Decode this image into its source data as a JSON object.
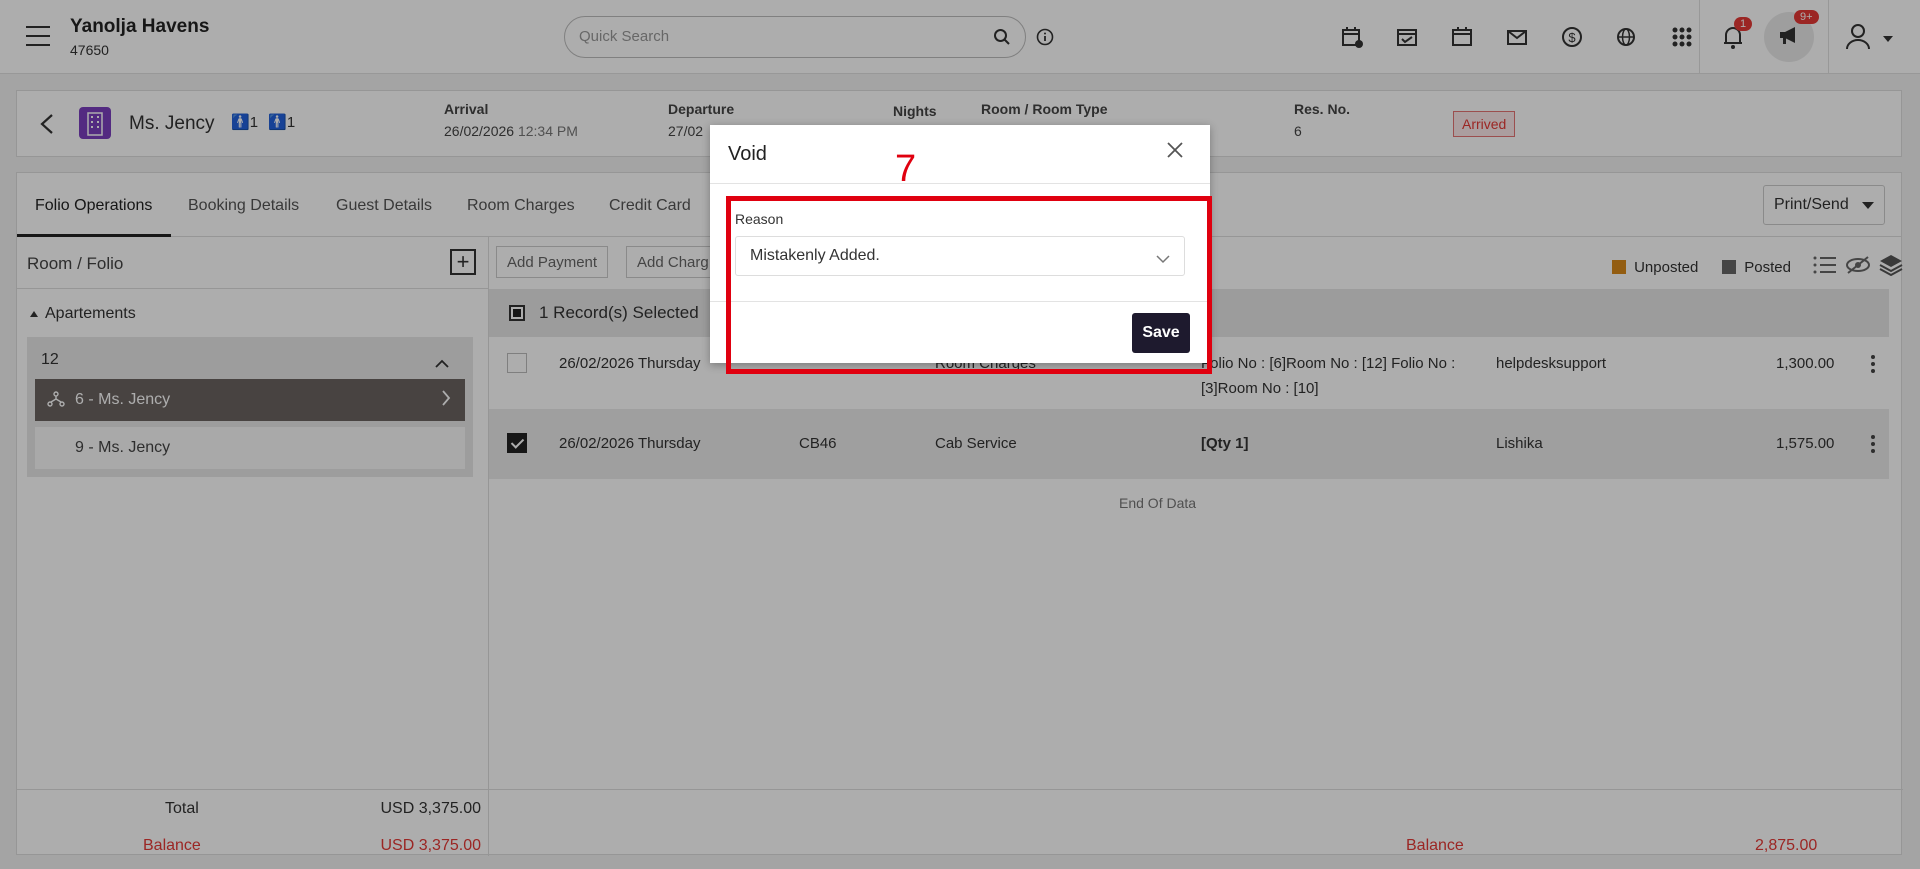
{
  "header": {
    "hotel_name": "Yanolja Havens",
    "hotel_code": "47650",
    "search_placeholder": "Quick Search",
    "notification_count": "1",
    "announcement_count": "9+"
  },
  "reservation": {
    "guest_name": "Ms. Jency",
    "adults": "1",
    "children": "1",
    "arrival_label": "Arrival",
    "arrival_date": "26/02/2026",
    "arrival_time": "12:34 PM",
    "departure_label": "Departure",
    "departure_value": "27/02",
    "nights_label": "Nights",
    "room_type_label": "Room / Room Type",
    "res_no_label": "Res. No.",
    "res_no_value": "6",
    "status": "Arrived"
  },
  "tabs": [
    "Folio Operations",
    "Booking Details",
    "Guest Details",
    "Room Charges",
    "Credit Card"
  ],
  "print_send_label": "Print/Send",
  "left_pane": {
    "title": "Room / Folio",
    "group": "Apartements",
    "room": "12",
    "folios": [
      "6 - Ms. Jency",
      "9 - Ms. Jency"
    ],
    "total_label": "Total",
    "total_value": "USD 3,375.00",
    "balance_label": "Balance",
    "balance_value": "USD 3,375.00"
  },
  "toolbar": {
    "add_payment": "Add Payment",
    "add_charge": "Add Charg",
    "legend_unposted": "Unposted",
    "legend_posted": "Posted"
  },
  "selection_text": "1 Record(s) Selected",
  "rows": [
    {
      "date": "26/02/2026 Thursday",
      "code": "",
      "desc": "Room Charges",
      "detail_1": "Folio No : [6]Room No : [12] Folio No :",
      "detail_2": "[3]Room No : [10]",
      "user": "helpdesksupport",
      "amount": "1,300.00"
    },
    {
      "date": "26/02/2026 Thursday",
      "code": "CB46",
      "desc": "Cab Service",
      "detail_1": "[Qty 1]",
      "detail_2": "",
      "user": "Lishika",
      "amount": "1,575.00"
    }
  ],
  "end_of_data": "End Of Data",
  "right_balance_label": "Balance",
  "right_balance_value": "2,875.00",
  "dialog": {
    "title": "Void",
    "reason_label": "Reason",
    "reason_value": "Mistakenly Added.",
    "save_label": "Save"
  },
  "step_number": "7",
  "colors": {
    "unposted": "#d98a1a",
    "posted": "#666666",
    "balance": "#e53935",
    "highlight": "#e0000f"
  }
}
